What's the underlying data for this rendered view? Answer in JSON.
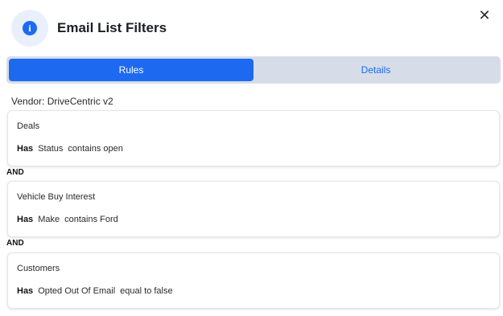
{
  "dialog": {
    "title": "Email List Filters",
    "close_label": "✕",
    "info_glyph": "i"
  },
  "tabs": [
    {
      "label": "Rules",
      "active": true
    },
    {
      "label": "Details",
      "active": false
    }
  ],
  "vendor_label": "Vendor: DriveCentric v2",
  "rules": [
    {
      "category": "Deals",
      "has": "Has",
      "field": "Status",
      "condition": "contains open"
    },
    {
      "category": "Vehicle Buy Interest",
      "has": "Has",
      "field": "Make",
      "condition": "contains Ford"
    },
    {
      "category": "Customers",
      "has": "Has",
      "field": "Opted Out Of Email",
      "condition": "equal to false"
    }
  ],
  "connectors": [
    "AND",
    "AND"
  ],
  "colors": {
    "accent": "#1d6af1",
    "tab_track": "#d7dde8",
    "icon_bg": "#eaf0fb"
  }
}
